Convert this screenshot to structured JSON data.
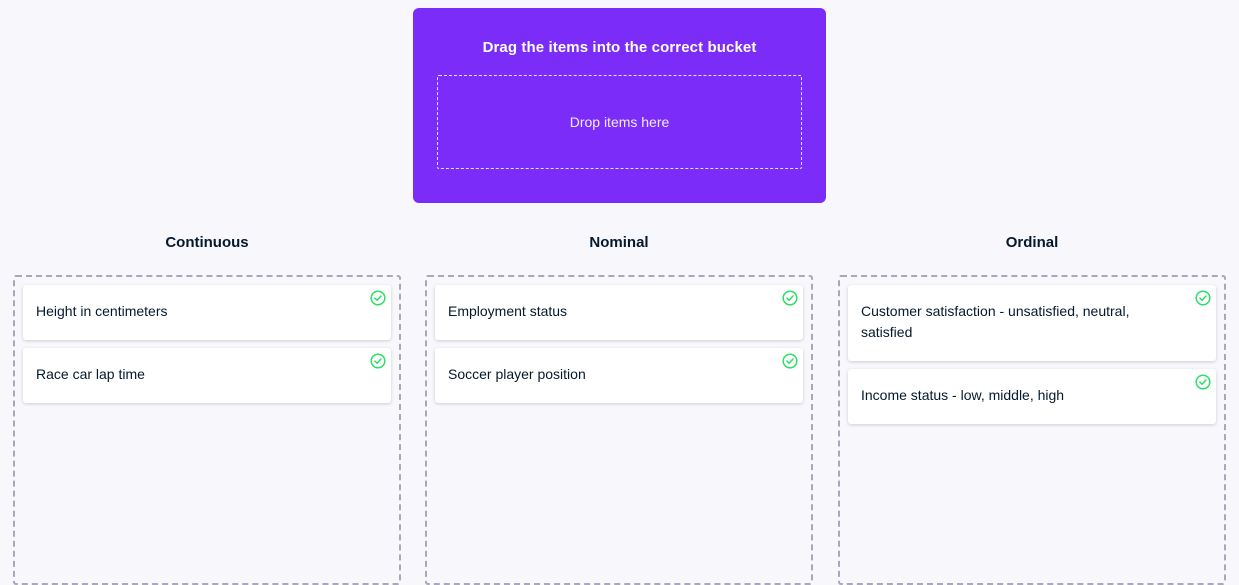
{
  "source": {
    "title": "Drag the items into the correct bucket",
    "dropzone_label": "Drop items here"
  },
  "buckets": [
    {
      "title": "Continuous",
      "items": [
        {
          "label": "Height in centimeters",
          "status": "correct"
        },
        {
          "label": "Race car lap time",
          "status": "correct"
        }
      ]
    },
    {
      "title": "Nominal",
      "items": [
        {
          "label": "Employment status",
          "status": "correct"
        },
        {
          "label": "Soccer player position",
          "status": "correct"
        }
      ]
    },
    {
      "title": "Ordinal",
      "items": [
        {
          "label": "Customer satisfaction - unsatisfied, neutral, satisfied",
          "status": "correct"
        },
        {
          "label": "Income status - low, middle, high",
          "status": "correct"
        }
      ]
    }
  ],
  "colors": {
    "accent": "#7b2cf9",
    "correct": "#2ede68",
    "bucket_border": "#a9a7b8",
    "text": "#05192d"
  },
  "icons": {
    "correct": "check-circle-icon"
  }
}
